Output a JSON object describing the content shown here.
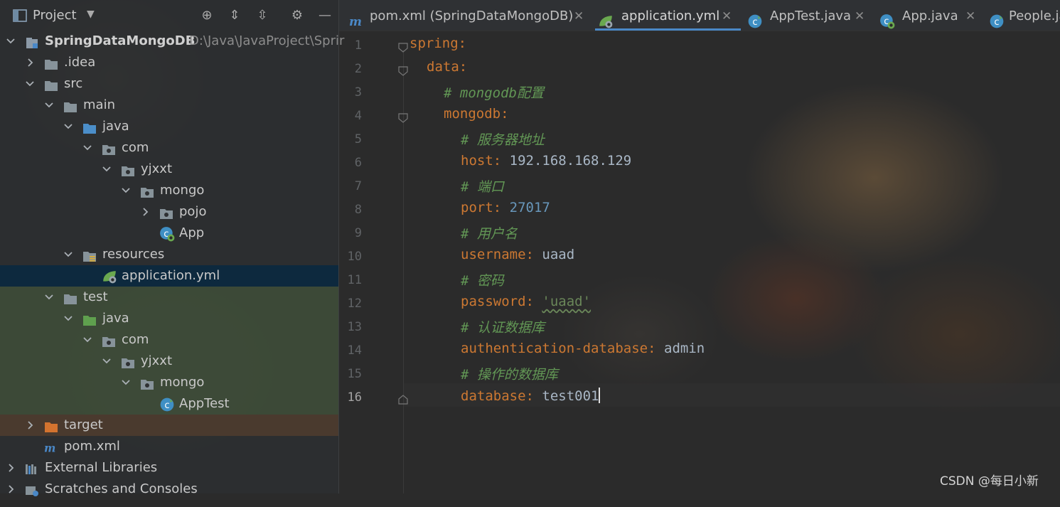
{
  "project_panel": {
    "title": "Project",
    "tree": [
      {
        "label": "SpringDataMongoDB",
        "path": "D:\\Java\\JavaProject\\Sprir",
        "depth": 0,
        "expanded": true,
        "icon": "module-icon",
        "bold": true
      },
      {
        "label": ".idea",
        "depth": 1,
        "expanded": false,
        "icon": "folder-icon"
      },
      {
        "label": "src",
        "depth": 1,
        "expanded": true,
        "icon": "folder-icon"
      },
      {
        "label": "main",
        "depth": 2,
        "expanded": true,
        "icon": "folder-icon"
      },
      {
        "label": "java",
        "depth": 3,
        "expanded": true,
        "icon": "source-folder-icon"
      },
      {
        "label": "com",
        "depth": 4,
        "expanded": true,
        "icon": "package-icon"
      },
      {
        "label": "yjxxt",
        "depth": 5,
        "expanded": true,
        "icon": "package-icon"
      },
      {
        "label": "mongo",
        "depth": 6,
        "expanded": true,
        "icon": "package-icon"
      },
      {
        "label": "pojo",
        "depth": 7,
        "expanded": false,
        "icon": "package-icon"
      },
      {
        "label": "App",
        "depth": 7,
        "icon": "spring-class-icon"
      },
      {
        "label": "resources",
        "depth": 3,
        "expanded": true,
        "icon": "resources-folder-icon"
      },
      {
        "label": "application.yml",
        "depth": 4,
        "icon": "spring-yml-icon",
        "selected": true
      },
      {
        "label": "test",
        "depth": 2,
        "expanded": true,
        "icon": "folder-icon"
      },
      {
        "label": "java",
        "depth": 3,
        "expanded": true,
        "icon": "test-folder-icon"
      },
      {
        "label": "com",
        "depth": 4,
        "expanded": true,
        "icon": "package-icon"
      },
      {
        "label": "yjxxt",
        "depth": 5,
        "expanded": true,
        "icon": "package-icon"
      },
      {
        "label": "mongo",
        "depth": 6,
        "expanded": true,
        "icon": "package-icon"
      },
      {
        "label": "AppTest",
        "depth": 7,
        "icon": "class-icon"
      },
      {
        "label": "target",
        "depth": 1,
        "expanded": false,
        "icon": "excluded-folder-icon"
      },
      {
        "label": "pom.xml",
        "depth": 1,
        "icon": "maven-icon"
      },
      {
        "label": "External Libraries",
        "depth": 0,
        "expanded": false,
        "icon": "libraries-icon"
      },
      {
        "label": "Scratches and Consoles",
        "depth": 0,
        "expanded": false,
        "icon": "scratches-icon"
      }
    ]
  },
  "tabs": [
    {
      "label": "pom.xml (SpringDataMongoDB)",
      "icon": "maven-icon",
      "active": false
    },
    {
      "label": "application.yml",
      "icon": "spring-yml-icon",
      "active": true
    },
    {
      "label": "AppTest.java",
      "icon": "class-icon",
      "active": false
    },
    {
      "label": "App.java",
      "icon": "spring-class-icon",
      "active": false
    },
    {
      "label": "People.ja",
      "icon": "class-icon",
      "active": false
    }
  ],
  "editor": {
    "current_line": 16,
    "lines": [
      {
        "n": "1",
        "indent": 0,
        "key": "spring",
        "sep": ":"
      },
      {
        "n": "2",
        "indent": 1,
        "key": "data",
        "sep": ":"
      },
      {
        "n": "3",
        "indent": 2,
        "comment": "# mongodb配置"
      },
      {
        "n": "4",
        "indent": 2,
        "key": "mongodb",
        "sep": ":"
      },
      {
        "n": "5",
        "indent": 3,
        "comment": "# 服务器地址"
      },
      {
        "n": "6",
        "indent": 3,
        "key": "host",
        "sep": ": ",
        "value": "192.168.168.129",
        "vtype": "plain"
      },
      {
        "n": "7",
        "indent": 3,
        "comment": "# 端口"
      },
      {
        "n": "8",
        "indent": 3,
        "key": "port",
        "sep": ": ",
        "value": "27017",
        "vtype": "number"
      },
      {
        "n": "9",
        "indent": 3,
        "comment": "# 用户名"
      },
      {
        "n": "10",
        "indent": 3,
        "key": "username",
        "sep": ": ",
        "value": "uaad",
        "vtype": "plain"
      },
      {
        "n": "11",
        "indent": 3,
        "comment": "# 密码"
      },
      {
        "n": "12",
        "indent": 3,
        "key": "password",
        "sep": ": ",
        "value": "'uaad'",
        "vtype": "string"
      },
      {
        "n": "13",
        "indent": 3,
        "comment": "# 认证数据库"
      },
      {
        "n": "14",
        "indent": 3,
        "key": "authentication-database",
        "sep": ": ",
        "value": "admin",
        "vtype": "plain"
      },
      {
        "n": "15",
        "indent": 3,
        "comment": "# 操作的数据库"
      },
      {
        "n": "16",
        "indent": 3,
        "key": "database",
        "sep": ": ",
        "value": "test001",
        "vtype": "plain",
        "caret": true
      }
    ]
  },
  "watermark": "CSDN @每日小新",
  "colors": {
    "key": "#cc7832",
    "comment": "#629755",
    "number": "#6897bb",
    "string": "#6a8759",
    "selection": "#0d293e",
    "tab_underline": "#4a88c7"
  }
}
